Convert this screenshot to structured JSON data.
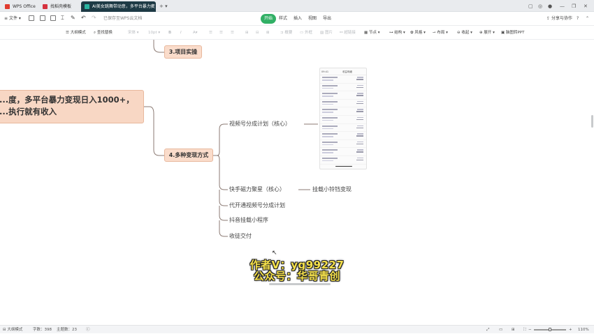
{
  "tabs": [
    {
      "label": "WPS Office",
      "color": "#e03b2f"
    },
    {
      "label": "找稻壳模板",
      "color": "#d6323f"
    },
    {
      "label": "AI美女跳舞带动意，多平台暴力变",
      "color": "#2bb4a1"
    }
  ],
  "menubar": {
    "file": "文件",
    "saved_status": "已保存至WPS云文档",
    "start": "开始",
    "style": "样式",
    "insert": "插入",
    "view": "视图",
    "export": "导出",
    "share": "分享与协作",
    "help": "?"
  },
  "toolbar": {
    "outline_mode": "大纲模式",
    "find_replace": "查找替换",
    "font": "宋体",
    "font_size": "10pt",
    "bold": "B",
    "italic": "I",
    "summary": "概要",
    "frame": "外框",
    "image": "图片",
    "hyperlink": "超链接",
    "node_size": "节点",
    "layout": "结构",
    "style": "风格",
    "structure": "布局",
    "collapse": "收起",
    "expand": "展开",
    "to_ppt": "脑图转PPT"
  },
  "mindmap": {
    "root": [
      "...度，多平台暴力变现日入1000+，",
      "...执行就有收入"
    ],
    "topic3": "3.项目实操",
    "topic4": "4.多种变现方式",
    "sub1": "视频号分成计划（核心）",
    "sub2": "快手磁力聚星（核心）",
    "sub2_child": "挂载小铃铛变现",
    "sub3": "代开通视频号分成计划",
    "sub4": "抖音挂载小程序",
    "sub5": "收徒交付",
    "phone_title": "收益明细",
    "phone_time": "09:41",
    "phone_rows": 11
  },
  "watermark": {
    "line1": "作者V：yg99227",
    "line2": "公众号：华哥青创"
  },
  "statusbar": {
    "mode": "大纲模式",
    "words": "字数：398",
    "topics": "主题数：23",
    "zoom": "110%",
    "zoom_level": 0.5
  }
}
